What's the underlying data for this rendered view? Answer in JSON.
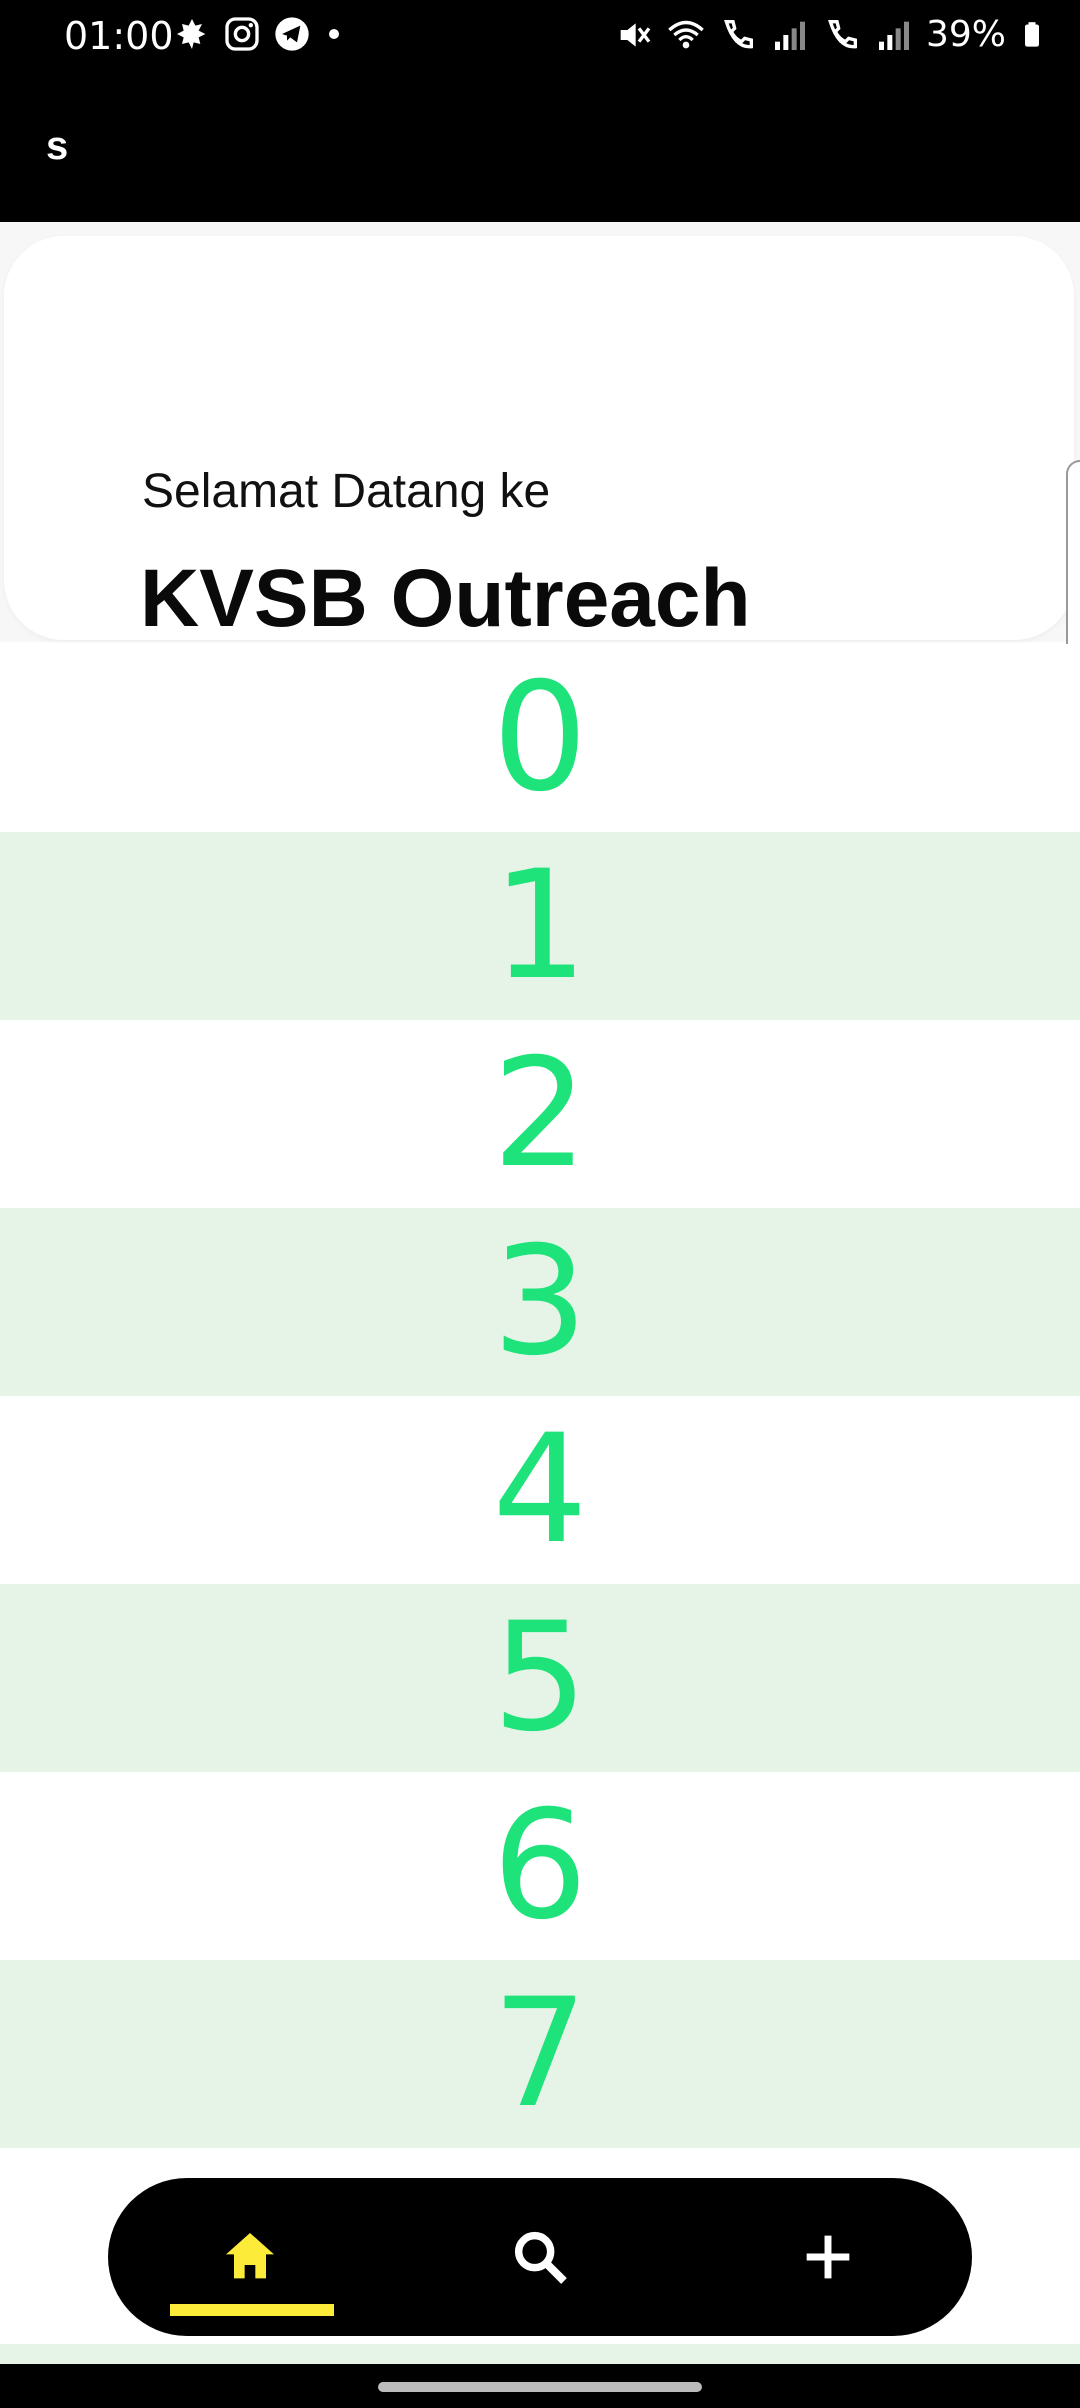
{
  "status_bar": {
    "time": "01:00",
    "battery": "39%",
    "left_icons": [
      "weather-icon",
      "instagram-icon",
      "telegram-icon",
      "dot-icon"
    ],
    "right_icons": [
      "mute-icon",
      "wifi-icon",
      "call-sim1-icon",
      "signal-icon",
      "call-sim2-icon",
      "signal-icon",
      "battery-icon"
    ]
  },
  "app_bar": {
    "title": "s"
  },
  "welcome": {
    "subtitle": "Selamat Datang ke",
    "title": "KVSB Outreach"
  },
  "list": {
    "items": [
      "0",
      "1",
      "2",
      "3",
      "4",
      "5",
      "6",
      "7"
    ]
  },
  "bottom_nav": {
    "items": [
      {
        "icon": "home-icon",
        "active": true
      },
      {
        "icon": "search-icon",
        "active": false
      },
      {
        "icon": "add-icon",
        "active": false
      }
    ],
    "active_color": "#fdeb3a",
    "background": "#000000"
  },
  "colors": {
    "number": "#1ee37b",
    "alt_row": "#e6f4e7",
    "app_bar": "#000000"
  }
}
